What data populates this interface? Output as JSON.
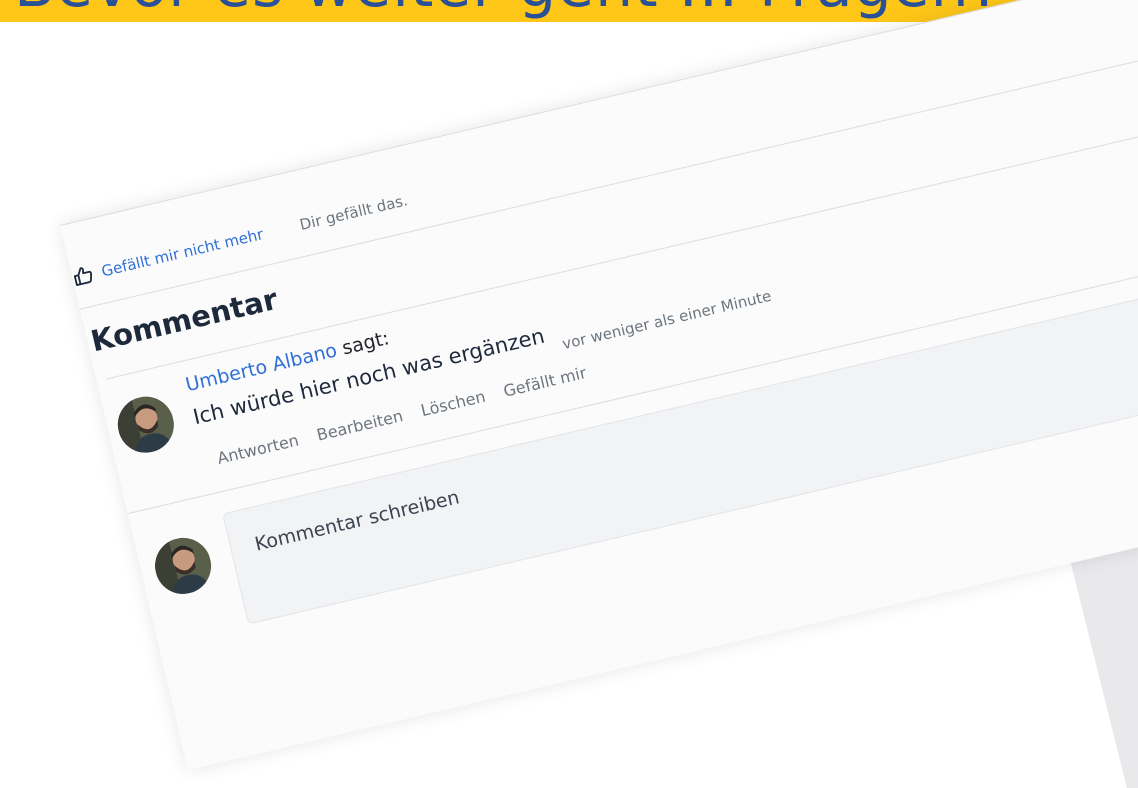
{
  "banner": {
    "text": "Bevor es weiter geht ... Fragen?",
    "background": "#fec718",
    "text_color": "#2a5098"
  },
  "like": {
    "icon": "thumbs-up-icon",
    "link_label": "Gefällt mir nicht mehr",
    "status": "Dir gefällt das."
  },
  "section": {
    "title": "Kommentar"
  },
  "comment": {
    "author": "Umberto Albano",
    "says": "sagt:",
    "body": "Ich würde hier noch was ergänzen",
    "actions": [
      "Antworten",
      "Bearbeiten",
      "Löschen",
      "Gefällt mir"
    ],
    "time": "vor weniger als einer Minute"
  },
  "compose": {
    "placeholder": "Kommentar schreiben"
  },
  "colors": {
    "link": "#2f6fd6",
    "muted": "#6c757d",
    "card_bg": "#fbfbfc"
  }
}
